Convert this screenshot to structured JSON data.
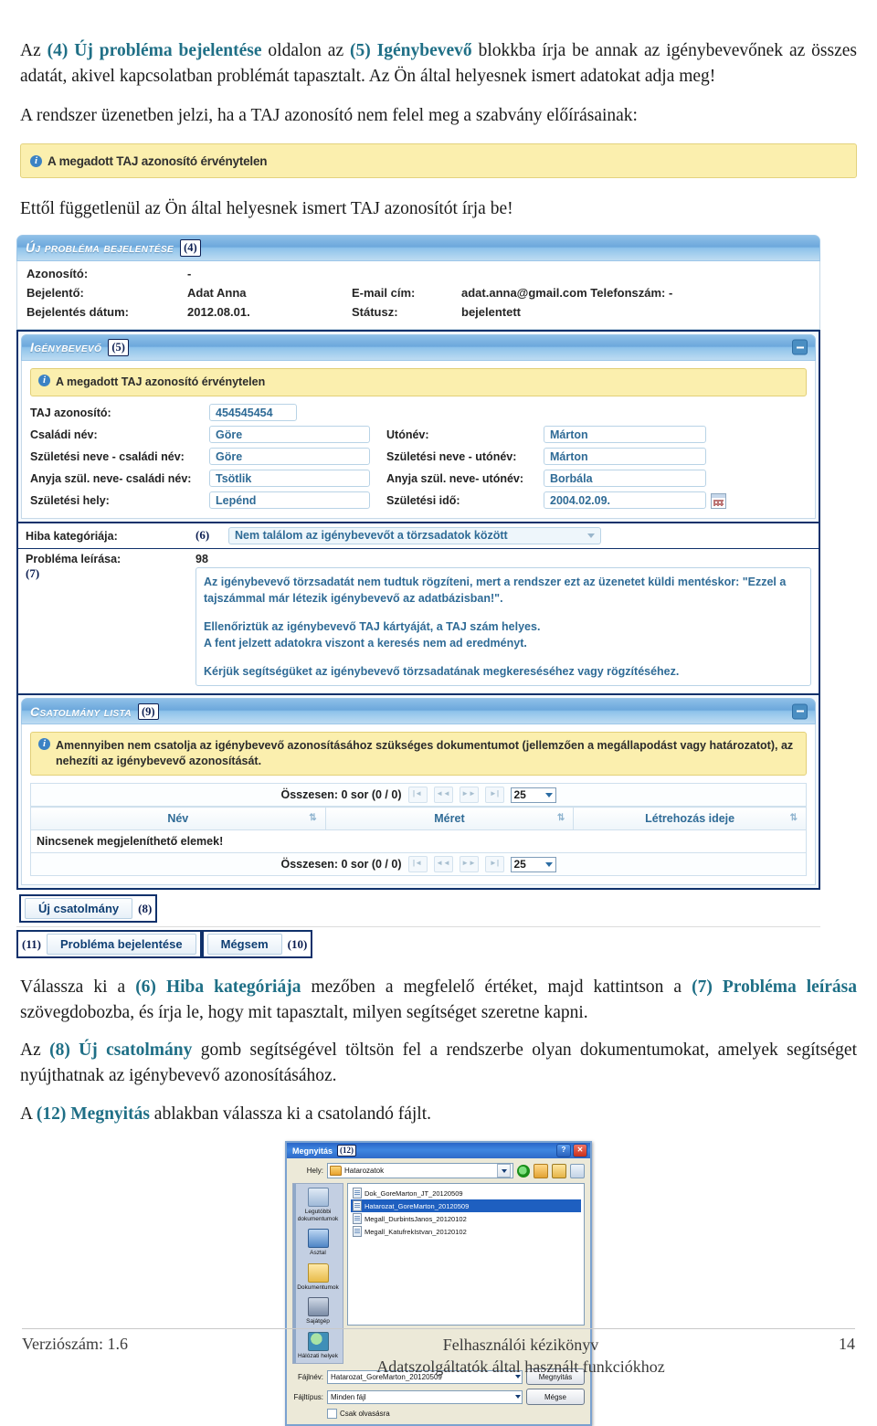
{
  "document": {
    "paragraphs": {
      "intro": {
        "seg1": "Az ",
        "ref1": "(4) Új probléma bejelentése",
        "seg2": " oldalon az ",
        "ref2": "(5) Igénybevevő",
        "seg3": " blokkba írja be annak az igénybevevőnek az összes adatát, akivel kapcsolatban problémát tapasztalt. Az Ön által helyesnek ismert adatokat adja meg!"
      },
      "system_msg": "A rendszer üzenetben jelzi, ha a TAJ azonosító nem felel meg a szabvány előírásainak:",
      "regardless": "Ettől függetlenül az Ön által helyesnek ismert TAJ azonosítót írja be!",
      "choose": {
        "seg1": "Válassza ki a ",
        "ref1": "(6) Hiba kategóriája",
        "seg2": " mezőben a megfelelő értéket, majd kattintson a ",
        "ref2": "(7) Probléma leírása",
        "seg3": " szövegdobozba, és írja le, hogy mit tapasztalt, milyen segítséget szeretne kapni."
      },
      "attachment": {
        "seg1": "Az ",
        "ref1": "(8) Új csatolmány",
        "seg2": " gomb segítségével töltsön fel a rendszerbe olyan dokumentumokat, amelyek segítséget nyújthatnak az igénybevevő azonosításához."
      },
      "open_dialog": {
        "seg1": "A ",
        "ref1": "(12) Megnyitás",
        "seg2": " ablakban válassza ki a csatolandó fájlt."
      }
    },
    "standalone_info": "A megadott TAJ azonosító érvénytelen"
  },
  "app": {
    "main_panel": {
      "title": "Új probléma bejelentése",
      "callout": "(4)"
    },
    "meta": {
      "rows": [
        {
          "label": "Azonosító:",
          "value": "-",
          "label2": "",
          "value2": ""
        },
        {
          "label": "Bejelentő:",
          "value": "Adat Anna",
          "label2": "E-mail cím:",
          "value2": "adat.anna@gmail.com Telefonszám:     -"
        },
        {
          "label": "Bejelentés dátum:",
          "value": "2012.08.01.",
          "label2": "Státusz:",
          "value2": "bejelentett"
        }
      ]
    },
    "beneficiary_panel": {
      "title": "Igénybevevő",
      "callout": "(5)",
      "info": "A megadott TAJ azonosító érvénytelen",
      "fields": {
        "taj_label": "TAJ azonosító:",
        "taj_value": "454545454",
        "family_name_label": "Családi név:",
        "family_name_value": "Göre",
        "given_name_label": "Utónév:",
        "given_name_value": "Márton",
        "birth_family_label": "Születési neve - családi név:",
        "birth_family_value": "Göre",
        "birth_given_label": "Születési neve - utónév:",
        "birth_given_value": "Márton",
        "mother_family_label": "Anyja szül. neve- családi név:",
        "mother_family_value": "Tsötlik",
        "mother_given_label": "Anyja szül. neve- utónév:",
        "mother_given_value": "Borbála",
        "birth_place_label": "Születési hely:",
        "birth_place_value": "Lepénd",
        "birth_date_label": "Születési idő:",
        "birth_date_value": "2004.02.09."
      }
    },
    "category": {
      "label": "Hiba kategóriája:",
      "callout": "(6)",
      "selected": "Nem találom az igénybevevőt a törzsadatok között"
    },
    "description": {
      "label": "Probléma leírása:",
      "callout": "(7)",
      "char_count": "98",
      "lines": [
        "Az igénybevevő törzsadatát nem tudtuk rögzíteni, mert a rendszer ezt az üzenetet küldi mentéskor: \"Ezzel a tajszámmal már létezik igénybevevő az adatbázisban!\".",
        "Ellenőriztük az igénybevevő TAJ kártyáját, a TAJ szám helyes.",
        "A fent jelzett adatokra viszont a keresés nem ad eredményt.",
        "Kérjük segítségüket az igénybevevő törzsadatának megkereséséhez vagy rögzítéséhez."
      ]
    },
    "attachments": {
      "title": "Csatolmány lista",
      "callout": "(9)",
      "info": "Amennyiben nem csatolja az igénybevevő azonosításához szükséges dokumentumot (jellemzően a megállapodást vagy határozatot), az nehezíti az igénybevevő azonosítását.",
      "pager_text": "Összesen: 0 sor (0 / 0)",
      "page_size": "25",
      "columns": [
        "Név",
        "Méret",
        "Létrehozás ideje"
      ],
      "empty_text": "Nincsenek megjeleníthető elemek!"
    },
    "buttons": {
      "new_attachment": "Új csatolmány",
      "new_attachment_callout": "(8)",
      "submit": "Probléma bejelentése",
      "submit_callout": "(11)",
      "cancel": "Mégsem",
      "cancel_callout": "(10)"
    }
  },
  "open_dialog": {
    "title": "Megnyitás",
    "callout": "(12)",
    "help_glyph": "?",
    "close_glyph": "✕",
    "look_in_label": "Hely:",
    "look_in_value": "Hatarozatok",
    "toolbar_icons": [
      "back-icon",
      "up-one-level-icon",
      "new-folder-icon",
      "views-icon"
    ],
    "places": [
      "Legutóbbi dokumentumok",
      "Asztal",
      "Dokumentumok",
      "Sajátgép",
      "Hálózati helyek"
    ],
    "files": [
      {
        "name": "Dok_GoreMarton_JT_20120509",
        "selected": false
      },
      {
        "name": "Hatarozat_GoreMarton_20120509",
        "selected": true
      },
      {
        "name": "Megall_DurbintsJanos_20120102",
        "selected": false
      },
      {
        "name": "Megall_KatufrekIstvan_20120102",
        "selected": false
      }
    ],
    "file_name_label": "Fájlnév:",
    "file_name_value": "Hatarozat_GoreMarton_20120509",
    "file_type_label": "Fájltípus:",
    "file_type_value": "Minden fájl",
    "readonly_label": "Csak olvasásra",
    "open_button": "Megnyitás",
    "cancel_button": "Mégse"
  },
  "footer": {
    "version": "Verziószám: 1.6",
    "title_line1": "Felhasználói kézikönyv",
    "title_line2": "Adatszolgáltatók által használt funkciókhoz",
    "page": "14"
  },
  "colors": {
    "highlight": "#1f6f86",
    "panel_blue": "#6ca8dc",
    "info_yellow": "#fbefae",
    "field_blue_text": "#2f6b96",
    "callout_border": "#0d1f52"
  }
}
